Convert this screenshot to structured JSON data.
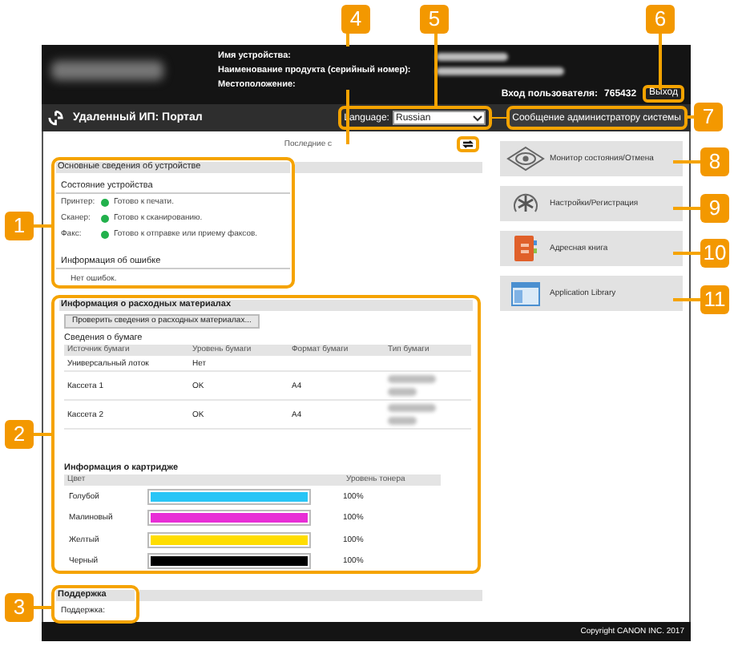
{
  "header": {
    "device_labels": [
      "Имя устройства:",
      "Наименование продукта (серийный номер):",
      "Местоположение:"
    ],
    "login_label": "Вход пользователя:",
    "login_user": "765432",
    "logout_button": "Выход"
  },
  "toolbar": {
    "title": "Удаленный ИП: Портал",
    "language_label": "Language:",
    "language_value": "Russian",
    "admin_button": "Сообщение администратору системы"
  },
  "last_updated": "Последние с",
  "device_info": {
    "title": "Основные сведения об устройстве",
    "status_title": "Состояние устройства",
    "statuses": [
      {
        "label": "Принтер:",
        "text": "Готово к печати.",
        "color": "#22b14c"
      },
      {
        "label": "Сканер:",
        "text": "Готово к сканированию.",
        "color": "#22b14c"
      },
      {
        "label": "Факс:",
        "text": "Готово к отправке или приему факсов.",
        "color": "#22b14c"
      }
    ],
    "error_title": "Информация об ошибке",
    "error_text": "Нет ошибок."
  },
  "consumables": {
    "title": "Информация о расходных материалах",
    "check_button": "Проверить сведения о расходных материалах...",
    "paper_title": "Сведения о бумаге",
    "paper_columns": [
      "Источник бумаги",
      "Уровень бумаги",
      "Формат бумаги",
      "Тип бумаги"
    ],
    "paper_rows": [
      {
        "source": "Универсальный лоток",
        "level": "Нет",
        "type_redacted": false
      },
      {
        "source": "Кассета 1",
        "level": "OK",
        "format": "A4",
        "type_redacted": true
      },
      {
        "source": "Кассета 2",
        "level": "OK",
        "format": "A4",
        "type_redacted": true
      }
    ],
    "cartridge_title": "Информация о картридже",
    "cartridge_columns": [
      "Цвет",
      "Уровень тонера"
    ],
    "cartridges": [
      {
        "name": "Голубой",
        "color": "#29c5f6",
        "level": 1,
        "reading": "100%"
      },
      {
        "name": "Малиновый",
        "color": "#e82ed6",
        "level": 1,
        "reading": "100%"
      },
      {
        "name": "Желтый",
        "color": "#ffdd00",
        "level": 1,
        "reading": "100%"
      },
      {
        "name": "Черный",
        "color": "#000000",
        "level": 1,
        "reading": "100%"
      }
    ]
  },
  "support": {
    "title": "Поддержка",
    "label": "Поддержка:"
  },
  "menu": [
    {
      "label": "Монитор состояния/Отмена",
      "kind": "eye"
    },
    {
      "label": "Настройки/Регистрация",
      "kind": "settings"
    },
    {
      "label": "Адресная книга",
      "kind": "book"
    },
    {
      "label": "Application Library",
      "kind": "window"
    }
  ],
  "footer": "Copyright CANON INC. 2017",
  "callouts": [
    "1",
    "2",
    "3",
    "4",
    "5",
    "6",
    "7",
    "8",
    "9",
    "10",
    "11"
  ]
}
